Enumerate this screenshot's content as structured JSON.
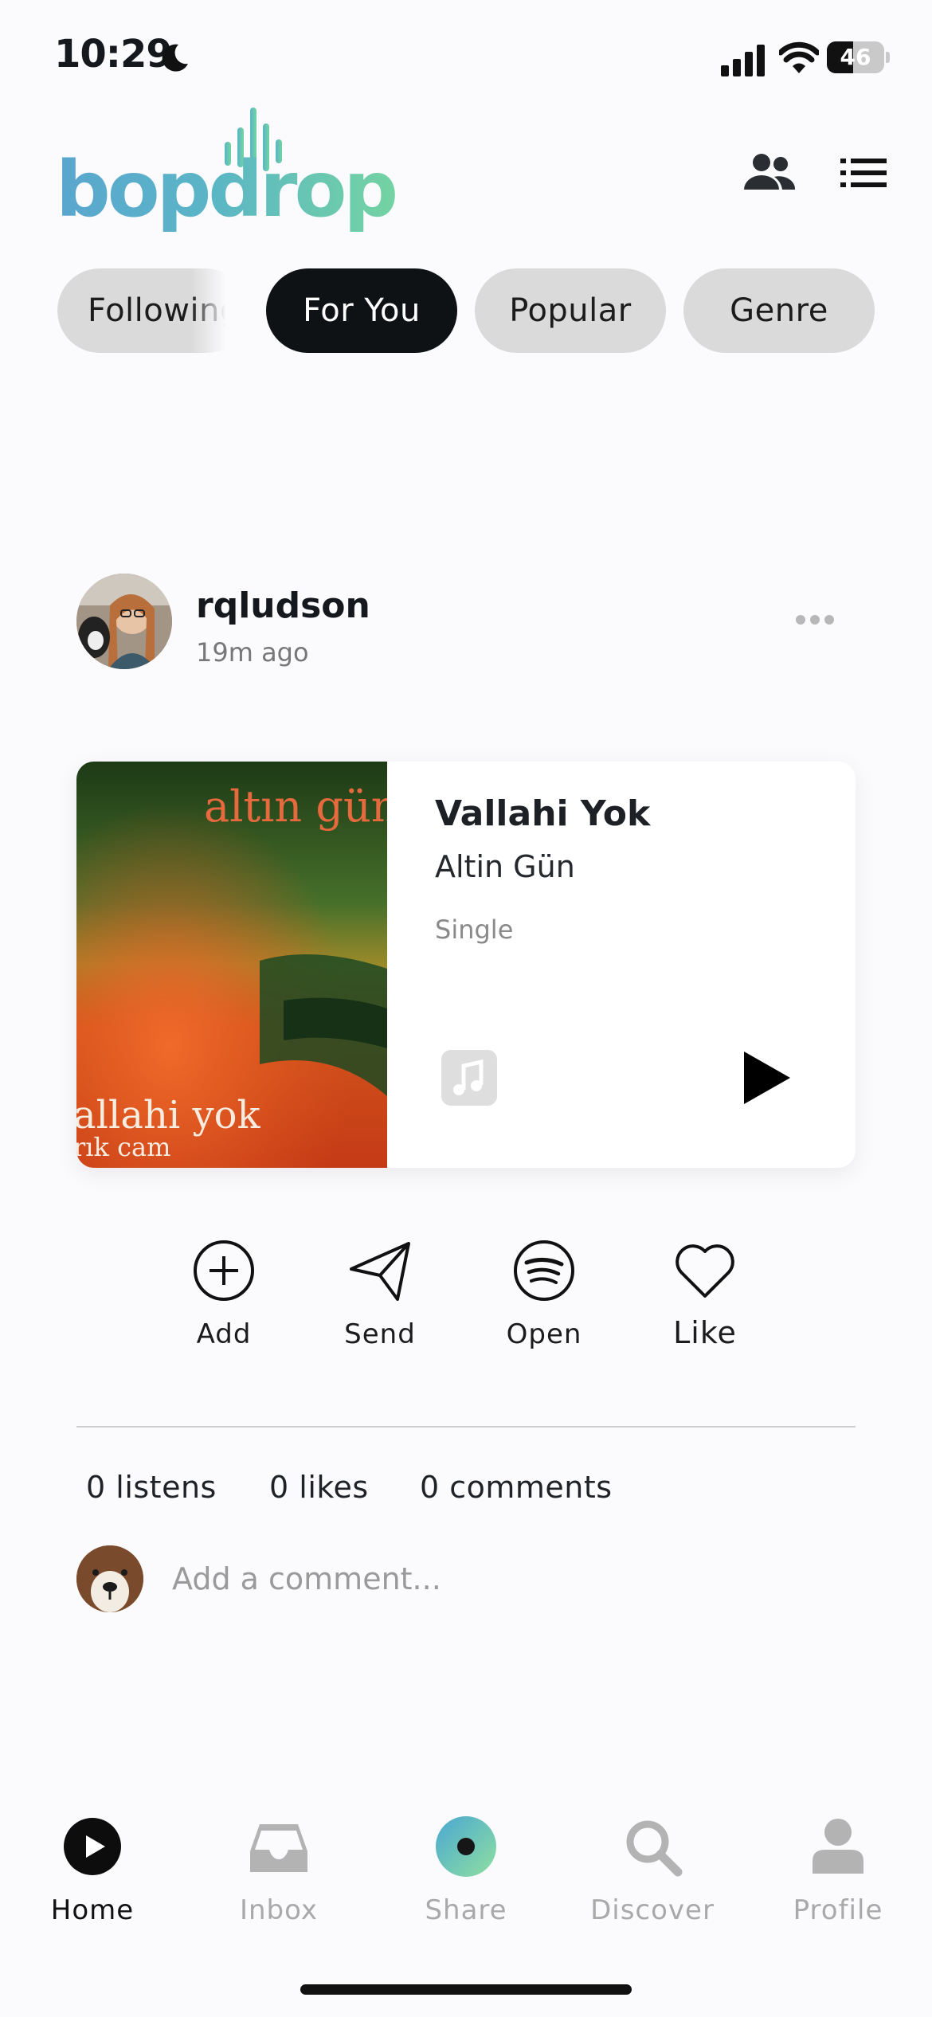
{
  "status_bar": {
    "time": "10:29",
    "battery": "46",
    "battery_level": 0.46
  },
  "header": {
    "logo_text": "bopdrop",
    "icons": [
      "friends-icon",
      "list-icon"
    ]
  },
  "tabs": [
    {
      "label": "Following",
      "active": false
    },
    {
      "label": "For You",
      "active": true
    },
    {
      "label": "Popular",
      "active": false
    },
    {
      "label": "Genre",
      "active": false
    }
  ],
  "post": {
    "username": "rqludson",
    "time_ago": "19m ago",
    "track": {
      "title": "Vallahi Yok",
      "artist": "Altin Gün",
      "type": "Single",
      "art_text_top": "altın gün",
      "art_text_bottom": "allahi yok",
      "art_text_sub": "rık cam"
    },
    "actions": [
      {
        "label": "Add",
        "icon": "plus-circle-icon"
      },
      {
        "label": "Send",
        "icon": "paper-plane-icon"
      },
      {
        "label": "Open",
        "icon": "spotify-icon"
      },
      {
        "label": "Like",
        "icon": "heart-icon"
      }
    ],
    "stats": {
      "listens": "0 listens",
      "likes": "0 likes",
      "comments": "0 comments"
    },
    "comment_placeholder": "Add a comment..."
  },
  "bottom_nav": [
    {
      "label": "Home",
      "icon": "home-play-icon",
      "active": true
    },
    {
      "label": "Inbox",
      "icon": "inbox-icon",
      "active": false
    },
    {
      "label": "Share",
      "icon": "share-orb-icon",
      "active": false
    },
    {
      "label": "Discover",
      "icon": "search-icon",
      "active": false
    },
    {
      "label": "Profile",
      "icon": "profile-icon",
      "active": false
    }
  ],
  "colors": {
    "active_tab": "#0e1215",
    "inactive_tab": "#dadada",
    "logo_blue": "#5aa6cf",
    "logo_green": "#74d3a2",
    "nav_inactive": "#a9a9a9"
  }
}
